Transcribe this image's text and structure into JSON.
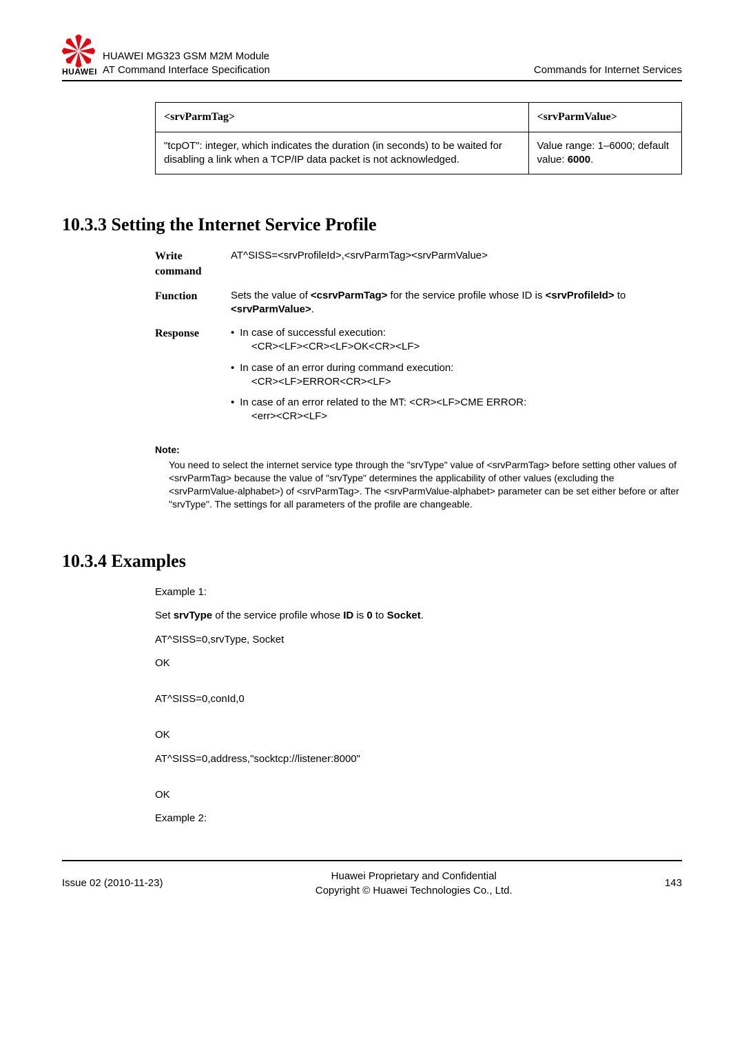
{
  "header": {
    "doc_title": "HUAWEI MG323 GSM M2M Module",
    "doc_subtitle": "AT Command Interface Specification",
    "chapter": "Commands for Internet Services",
    "logo_text": "HUAWEI"
  },
  "table": {
    "col1": "<srvParmTag>",
    "col2": "<srvParmValue>",
    "cell1": "\"tcpOT\": integer, which indicates the duration (in seconds) to be waited for disabling a link when a TCP/IP data packet is not acknowledged.",
    "cell2_pre": "Value range: 1–6000; default value: ",
    "cell2_bold": "6000",
    "cell2_post": "."
  },
  "section1": {
    "heading": "10.3.3 Setting the Internet Service Profile",
    "write_label": "Write command",
    "write_body": "AT^SISS=<srvProfileId>,<srvParmTag><srvParmValue>",
    "function_label": "Function",
    "function_pre": "Sets the value of ",
    "function_b1": "<csrvParmTag>",
    "function_mid": " for the service profile whose ID is ",
    "function_b2": "<srvProfileId>",
    "function_mid2": " to ",
    "function_b3": "<srvParmValue>",
    "function_post": ".",
    "response_label": "Response",
    "resp1_line1": "In case of successful execution:",
    "resp1_line2": "<CR><LF><CR><LF>OK<CR><LF>",
    "resp2_line1": "In case of an error during command execution:",
    "resp2_line2": "<CR><LF>ERROR<CR><LF>",
    "resp3_line1": "In case of an error related to the MT: <CR><LF>CME ERROR:",
    "resp3_line2": "<err><CR><LF>",
    "note_label": "Note:",
    "note_body": "You need to select the internet service type through the \"srvType\" value of <srvParmTag> before setting other values of <srvParmTag> because the value of \"srvType\" determines the applicability of other values (excluding the <srvParmValue-alphabet>) of <srvParmTag>. The <srvParmValue-alphabet> parameter can be set either before or after \"srvType\". The settings for all parameters of the profile are changeable."
  },
  "section2": {
    "heading": "10.3.4 Examples",
    "ex1_label": "Example 1:",
    "ex1_set_pre": "Set ",
    "ex1_b1": "srvType",
    "ex1_mid1": " of the service profile whose ",
    "ex1_b2": "ID",
    "ex1_mid2": " is ",
    "ex1_b3": "0",
    "ex1_mid3": " to ",
    "ex1_b4": "Socket",
    "ex1_post": ".",
    "cmd1": "AT^SISS=0,srvType, Socket",
    "ok": "OK",
    "cmd2": "AT^SISS=0,conId,0",
    "cmd3": "AT^SISS=0,address,\"socktcp://listener:8000\"",
    "ex2_label": "Example 2:"
  },
  "footer": {
    "issue": "Issue 02 (2010-11-23)",
    "line1": "Huawei Proprietary and Confidential",
    "line2": "Copyright © Huawei Technologies Co., Ltd.",
    "page": "143"
  }
}
